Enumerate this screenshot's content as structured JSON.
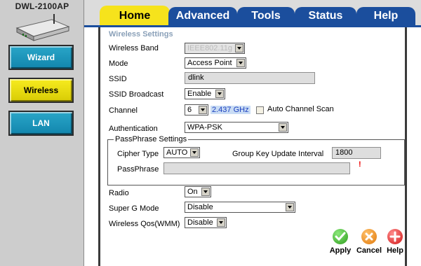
{
  "device": {
    "model": "DWL-2100AP"
  },
  "nav": {
    "wizard": "Wizard",
    "wireless": "Wireless",
    "lan": "LAN"
  },
  "tabs": {
    "home": "Home",
    "advanced": "Advanced",
    "tools": "Tools",
    "status": "Status",
    "help": "Help"
  },
  "page": {
    "section_title": "Wireless Settings",
    "wireless_band": {
      "label": "Wireless Band",
      "value": "IEEE802.11g"
    },
    "mode": {
      "label": "Mode",
      "value": "Access Point"
    },
    "ssid": {
      "label": "SSID",
      "value": "dlink"
    },
    "ssid_broadcast": {
      "label": "SSID Broadcast",
      "value": "Enable"
    },
    "channel": {
      "label": "Channel",
      "value": "6",
      "frequency": "2.437 GHz",
      "auto_scan_label": "Auto Channel Scan"
    },
    "authentication": {
      "label": "Authentication",
      "value": "WPA-PSK"
    },
    "passphrase_settings": {
      "legend": "PassPhrase Settings",
      "cipher_label": "Cipher Type",
      "cipher_value": "AUTO",
      "group_key_label": "Group Key Update Interval",
      "group_key_value": "1800",
      "passphrase_label": "PassPhrase",
      "passphrase_value": "",
      "required_mark": "!"
    },
    "radio": {
      "label": "Radio",
      "value": "On"
    },
    "super_g": {
      "label": "Super G Mode",
      "value": "Disable"
    },
    "qos": {
      "label": "Wireless Qos(WMM)",
      "value": "Disable"
    }
  },
  "actions": {
    "apply": "Apply",
    "cancel": "Cancel",
    "help": "Help"
  },
  "colors": {
    "tab_active": "#f6e31c",
    "tab_inactive": "#1b4e9d",
    "nav_teal": "#1286ad",
    "nav_yellow": "#f7ec1f"
  }
}
